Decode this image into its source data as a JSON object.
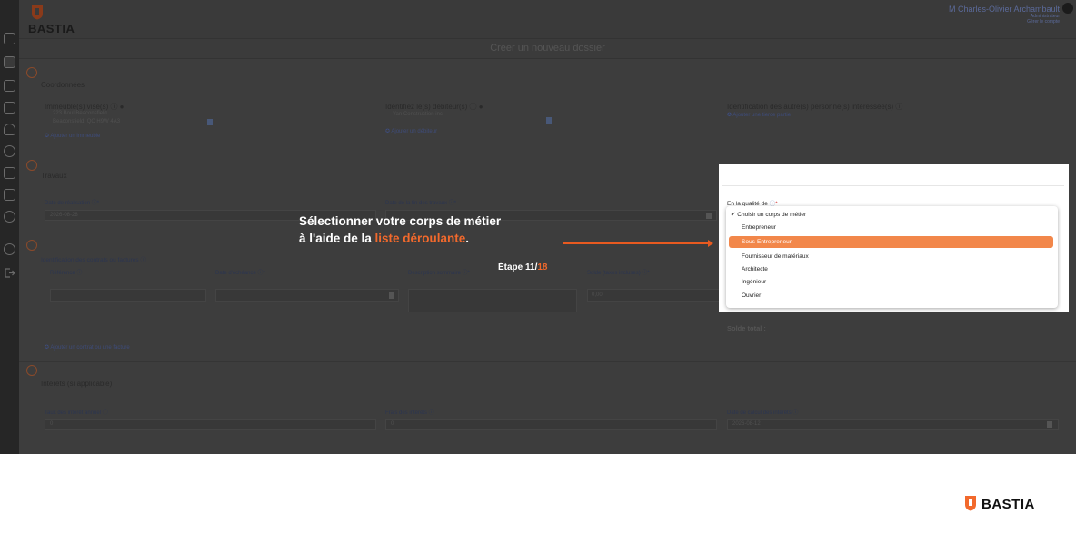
{
  "header": {
    "brand": "BASTIA",
    "user_name": "M Charles-Olivier Archambault",
    "user_role": "Administrateur",
    "user_link": "Gérer le compte"
  },
  "page_title": "Créer un nouveau dossier",
  "sections": {
    "coordonnees": {
      "number": "1",
      "title": "Coordonnées",
      "immeubles_label": "Immeuble(s) visé(s) ⓘ ●",
      "immeuble_line1": "223 Boul Beaconsfield",
      "immeuble_line2": "Beaconsfield, QC H9W 4A3",
      "add_immeuble": "✪ Ajouter un immeuble",
      "debiteurs_label": "Identifiez le(s) débiteur(s) ⓘ ●",
      "debiteur_value": "Yan Construction inc.",
      "add_debiteur": "✪ Ajouter un débiteur",
      "autres_label": "Identification des autre(s) personne(s) intéressée(s) ⓘ",
      "add_tierce": "✪ Ajouter une tierce partie"
    },
    "travaux": {
      "number": "2",
      "title": "Travaux",
      "date_realisation_label": "Date de réalisation ⓘ*",
      "date_realisation_value": "2026-08-28",
      "date_fin_label": "Date de la fin des travaux ⓘ*"
    },
    "contrats": {
      "number": "3",
      "title": "Identification des contrats ou factures ⓘ",
      "col_reference": "Référence ⓘ",
      "col_echeance": "Date d'échéance ⓘ*",
      "col_description": "Description sommaire ⓘ*",
      "col_solde": "Solde (taxes incluses) ⓘ*",
      "solde_value": "0,00",
      "add_contrat": "✪ Ajouter un contrat ou une facture",
      "solde_total": "Solde total :"
    },
    "interets": {
      "number": "4",
      "title": "Intérêts (si applicable)",
      "taux_label": "Taux des intérêt annuel ⓘ",
      "taux_value": "0",
      "frais_label": "Frais des intérêts ⓘ",
      "frais_value": "0",
      "date_calcul_label": "Date de calcul des intérêts ⓘ",
      "date_calcul_value": "2026-08-12"
    }
  },
  "overlay": {
    "line1": "Sélectionner votre corps de métier",
    "line2_prefix": "à l'aide de la ",
    "line2_accent": "liste déroulante",
    "line2_suffix": ".",
    "etape_prefix": "Étape 11/",
    "etape_total": "18",
    "accent_color": "#f2692c"
  },
  "dropdown": {
    "label": "En la qualité de",
    "options": [
      "Choisir un corps de métier",
      "Entrepreneur",
      "Sous-Entrepreneur",
      "Fournisseur de matériaux",
      "Architecte",
      "Ingénieur",
      "Ouvrier"
    ],
    "checked_option": "Choisir un corps de métier",
    "highlighted_option": "Sous-Entrepreneur",
    "highlight_color": "#f2874a"
  },
  "footer": {
    "brand": "BASTIA"
  }
}
